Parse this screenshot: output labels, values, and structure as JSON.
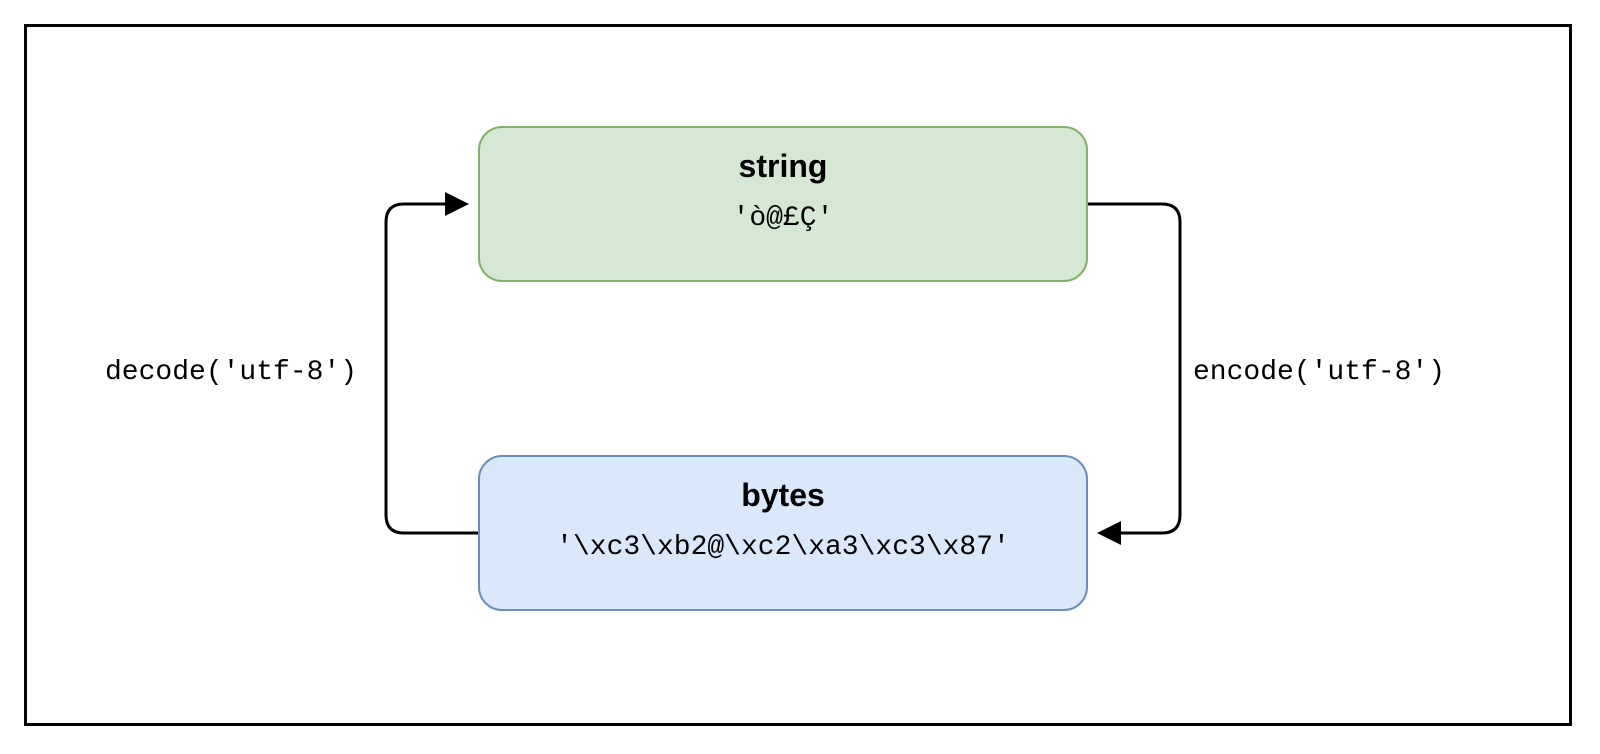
{
  "diagram": {
    "string_node": {
      "title": "string",
      "value": "'ò@£Ç'"
    },
    "bytes_node": {
      "title": "bytes",
      "value": "'\\xc3\\xb2@\\xc2\\xa3\\xc3\\x87'"
    },
    "decode_label": "decode('utf-8')",
    "encode_label": "encode('utf-8')"
  }
}
